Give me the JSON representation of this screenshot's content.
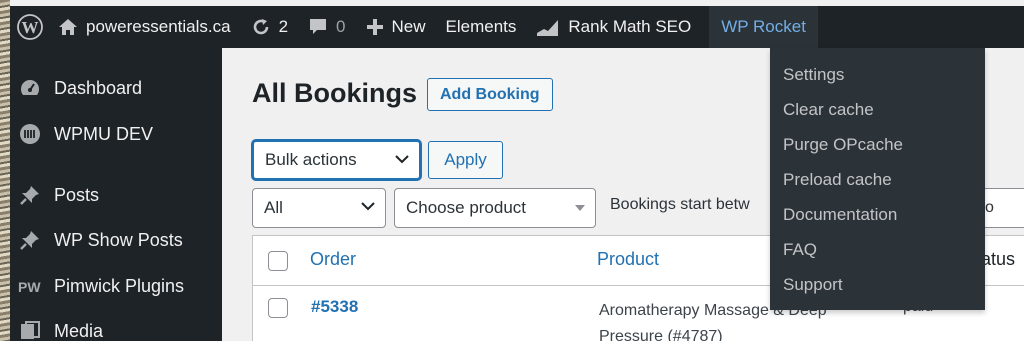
{
  "adminbar": {
    "site_name": "poweressentials.ca",
    "updates_count": "2",
    "comments_count": "0",
    "new_label": "New",
    "elements_label": "Elements",
    "rankmath_label": "Rank Math SEO",
    "wprocket_label": "WP Rocket"
  },
  "sidebar": {
    "items": [
      {
        "label": "Dashboard",
        "icon": "dashboard-icon"
      },
      {
        "label": "WPMU DEV",
        "icon": "wpmudev-icon"
      },
      {
        "label": "Posts",
        "icon": "pin-icon"
      },
      {
        "label": "WP Show Posts",
        "icon": "pin-icon"
      },
      {
        "label": "Pimwick Plugins",
        "icon": "pimwick-icon"
      },
      {
        "label": "Media",
        "icon": "media-icon"
      }
    ]
  },
  "main": {
    "title": "All Bookings",
    "add_button": "Add Booking",
    "bulk_actions": "Bulk actions",
    "apply": "Apply",
    "filter_all": "All",
    "filter_product": "Choose product",
    "date_label": "Bookings start betw",
    "date_partial": "o"
  },
  "table": {
    "headers": {
      "order": "Order",
      "product": "Product",
      "status": "atus"
    },
    "rows": [
      {
        "order": "#5338",
        "product": "Aromatherapy Massage & Deep Pressure (#4787)",
        "status": "paid"
      }
    ]
  },
  "wprocket_menu": {
    "items": [
      "Settings",
      "Clear cache",
      "Purge OPcache",
      "Preload cache",
      "Documentation",
      "FAQ",
      "Support"
    ]
  },
  "colors": {
    "adminbar_bg": "#1d2327",
    "submenu_bg": "#2c3338",
    "accent": "#2271b1",
    "active_text": "#72aee6"
  }
}
